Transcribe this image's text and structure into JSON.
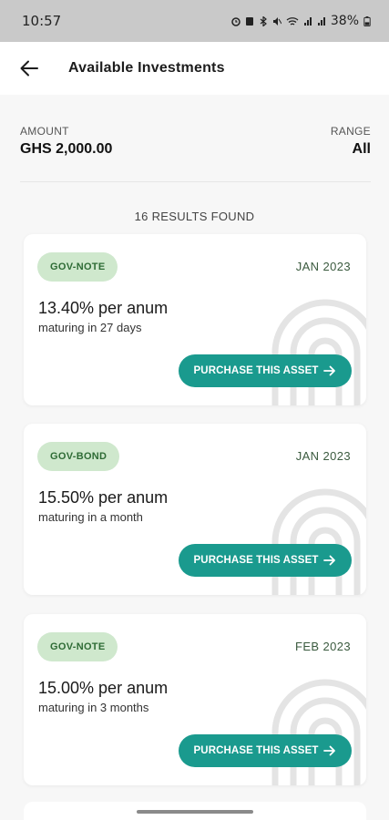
{
  "status_bar": {
    "time": "10:57",
    "battery": "38%",
    "icons": [
      "alarm-icon",
      "sim-icon",
      "bluetooth-icon",
      "mute-icon",
      "wifi-icon",
      "signal-icon",
      "signal-icon",
      "battery-icon"
    ]
  },
  "header": {
    "title": "Available Investments",
    "back_icon": "arrow-left-icon"
  },
  "summary": {
    "amount_label": "AMOUNT",
    "amount_value": "GHS 2,000.00",
    "range_label": "RANGE",
    "range_value": "All"
  },
  "results_text": "16 RESULTS FOUND",
  "colors": {
    "accent": "#1a9a8e",
    "badge_bg": "#cfe8cd",
    "badge_text": "#2e6b35"
  },
  "investments": [
    {
      "type": "GOV-NOTE",
      "date": "JAN 2023",
      "rate": "13.40% per anum",
      "maturity": "maturing in 27 days",
      "button": "PURCHASE THIS ASSET"
    },
    {
      "type": "GOV-BOND",
      "date": "JAN 2023",
      "rate": "15.50% per anum",
      "maturity": "maturing in a month",
      "button": "PURCHASE THIS ASSET"
    },
    {
      "type": "GOV-NOTE",
      "date": "FEB 2023",
      "rate": "15.00% per anum",
      "maturity": "maturing in 3 months",
      "button": "PURCHASE THIS ASSET"
    }
  ]
}
